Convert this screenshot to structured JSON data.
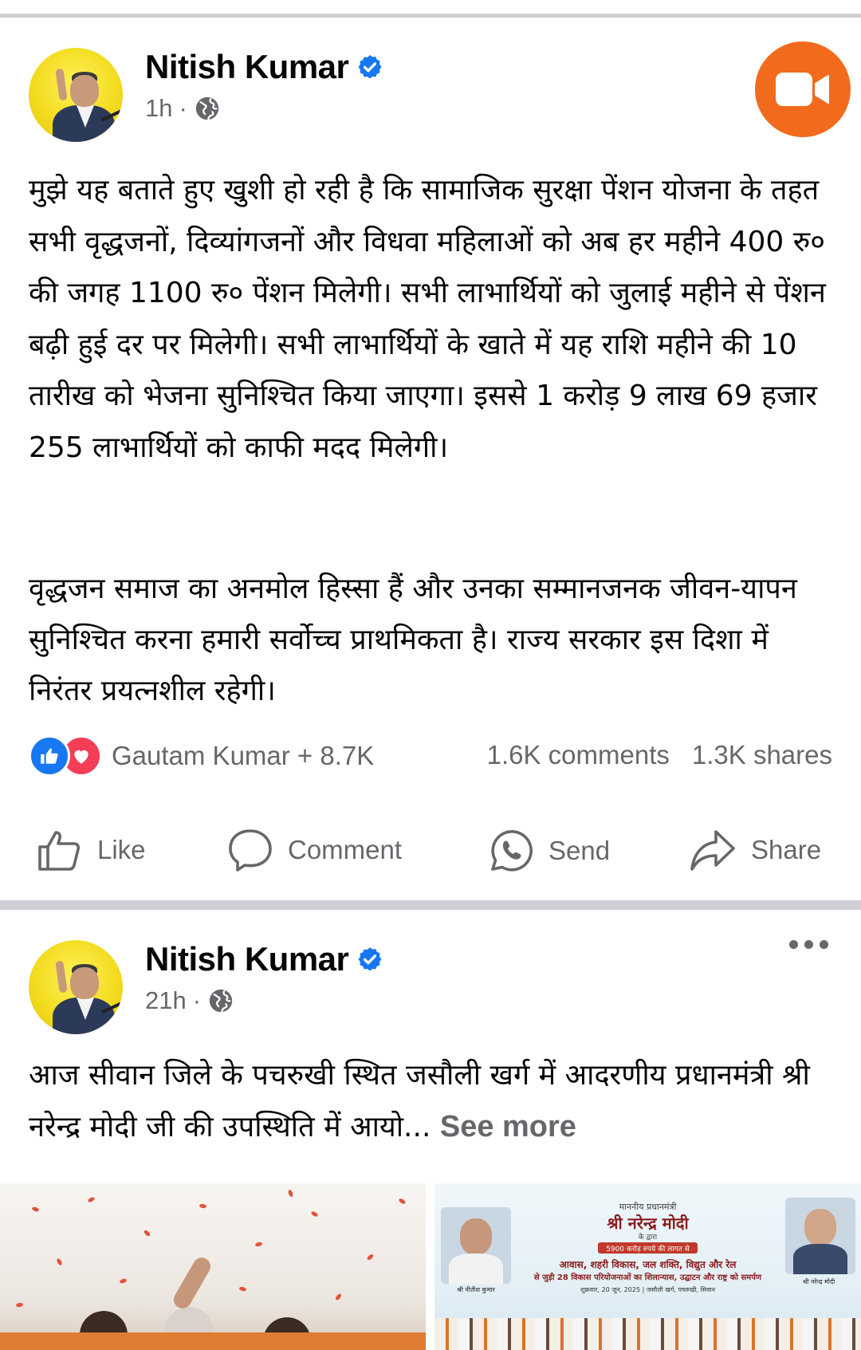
{
  "post1": {
    "author": "Nitish Kumar",
    "time": "1h",
    "separator": "·",
    "paragraph1": "मुझे यह बताते हुए खुशी हो रही है कि सामाजिक सुरक्षा पेंशन योजना के तहत सभी वृद्धजनों, दिव्यांगजनों और विधवा महिलाओं को अब हर महीने 400 रु० की जगह 1100 रु० पेंशन मिलेगी। सभी लाभार्थियों को जुलाई महीने से पेंशन बढ़ी हुई दर पर मिलेगी। सभी लाभार्थियों के खाते में यह राशि महीने की 10 तारीख को भेजना सुनिश्चित किया जाएगा। इससे 1 करोड़ 9 लाख 69 हजार 255 लाभार्थियों को काफी मदद मिलेगी।",
    "paragraph2": "वृद्धजन समाज का अनमोल हिस्सा हैं और उनका सम्मानजनक जीवन-यापन सुनिश्चित करना हमारी सर्वोच्च प्राथमिकता है। राज्य सरकार इस दिशा में निरंतर प्रयत्नशील रहेगी।",
    "reactions_text": "Gautam Kumar + 8.7K",
    "comments": "1.6K comments",
    "shares": "1.3K shares",
    "actions": {
      "like": "Like",
      "comment": "Comment",
      "send": "Send",
      "share": "Share"
    }
  },
  "post2": {
    "author": "Nitish Kumar",
    "time": "21h",
    "separator": "·",
    "text": "आज सीवान जिले के पचरुखी स्थित जसौली खर्ग में आदरणीय प्रधानमंत्री श्री नरेन्द्र मोदी जी की उपस्थिति में आयो...",
    "see_more": "See more",
    "banner": {
      "heading_small": "माननीय प्रधानमंत्री",
      "heading_name": "श्री नरेन्द्र मोदी",
      "by": "के द्वारा",
      "amount": "5900 करोड़ रुपये की लागत से",
      "line1": "आवास, शहरी विकास, जल शक्ति, विद्युत और रेल",
      "line2": "से जुड़ी 28 विकास परियोजनाओं का शिलान्यास, उद्घाटन और राष्ट्र को समर्पण",
      "date_place": "शुक्रवार, 20 जून, 2025 | जसौली खर्ग, पचरुखी, सिवान",
      "left_caption": "श्री नीतीश कुमार",
      "right_caption": "श्री नरेन्द्र मोदी"
    }
  },
  "colors": {
    "brand_blue": "#1877f2",
    "love_red": "#f33e58",
    "video_orange": "#f26b1d",
    "secondary_text": "#65676b",
    "divider": "#ced0d4"
  },
  "icons": {
    "verified": "verified-badge-icon",
    "globe": "globe-icon",
    "video": "video-camera-icon",
    "more": "more-dots-icon",
    "like": "thumbs-up-icon",
    "comment": "speech-bubble-icon",
    "send": "whatsapp-icon",
    "share": "share-arrow-icon"
  }
}
